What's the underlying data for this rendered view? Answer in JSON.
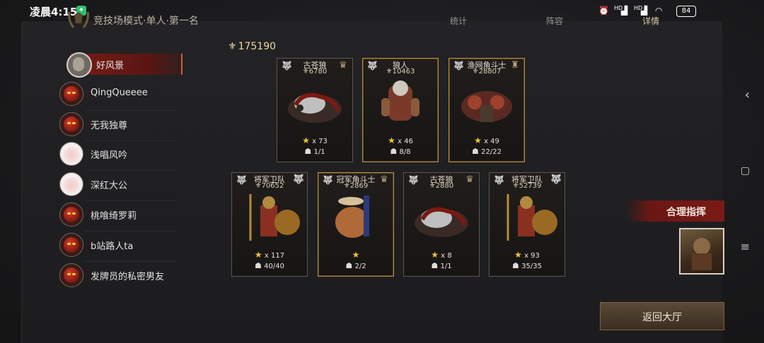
{
  "status_bar": {
    "time": "凌晨4:15",
    "network_1": "HD",
    "network_2": "HD",
    "battery": "84"
  },
  "header": {
    "title": "竞技场模式·单人·第一名",
    "tabs": [
      {
        "label": "统计"
      },
      {
        "label": "阵容"
      },
      {
        "label": "详情"
      }
    ]
  },
  "players": [
    {
      "name": "好风景",
      "avatar": "hero-avatar",
      "active": true
    },
    {
      "name": "QingQueeee",
      "avatar": "demon-avatar"
    },
    {
      "name": "无我独尊",
      "avatar": "demon-avatar"
    },
    {
      "name": "浅唱风吟",
      "avatar": "cloud-avatar"
    },
    {
      "name": "深红大公",
      "avatar": "cloud-avatar"
    },
    {
      "name": "桃喰绮罗莉",
      "avatar": "demon-avatar"
    },
    {
      "name": "b站路人ta",
      "avatar": "demon-avatar"
    },
    {
      "name": "发牌员的私密男友",
      "avatar": "demon-avatar"
    }
  ],
  "team_power": "175190",
  "cards": [
    {
      "name": "古苍狼",
      "power": "6780",
      "stars": "x 73",
      "count": "1/1",
      "gold": false
    },
    {
      "name": "狼人",
      "power": "10463",
      "stars": "x 46",
      "count": "8/8",
      "gold": true
    },
    {
      "name": "渔网角斗士",
      "power": "28807",
      "stars": "x 49",
      "count": "22/22",
      "gold": true
    },
    {
      "name": "将军卫队",
      "power": "70652",
      "stars": "x 117",
      "count": "40/40",
      "gold": false
    },
    {
      "name": "冠军角斗士",
      "power": "2869",
      "stars": "",
      "count": "2/2",
      "gold": true
    },
    {
      "name": "古苍狼",
      "power": "2880",
      "stars": "x 8",
      "count": "1/1",
      "gold": false
    },
    {
      "name": "将军卫队",
      "power": "52739",
      "stars": "x 93",
      "count": "35/35",
      "gold": false
    }
  ],
  "commander": {
    "label": "合理指挥"
  },
  "back_button": {
    "label": "返回大厅"
  },
  "colors": {
    "accent_red": "#7b1a16",
    "gold": "#b0893e",
    "star": "#f2c431"
  }
}
